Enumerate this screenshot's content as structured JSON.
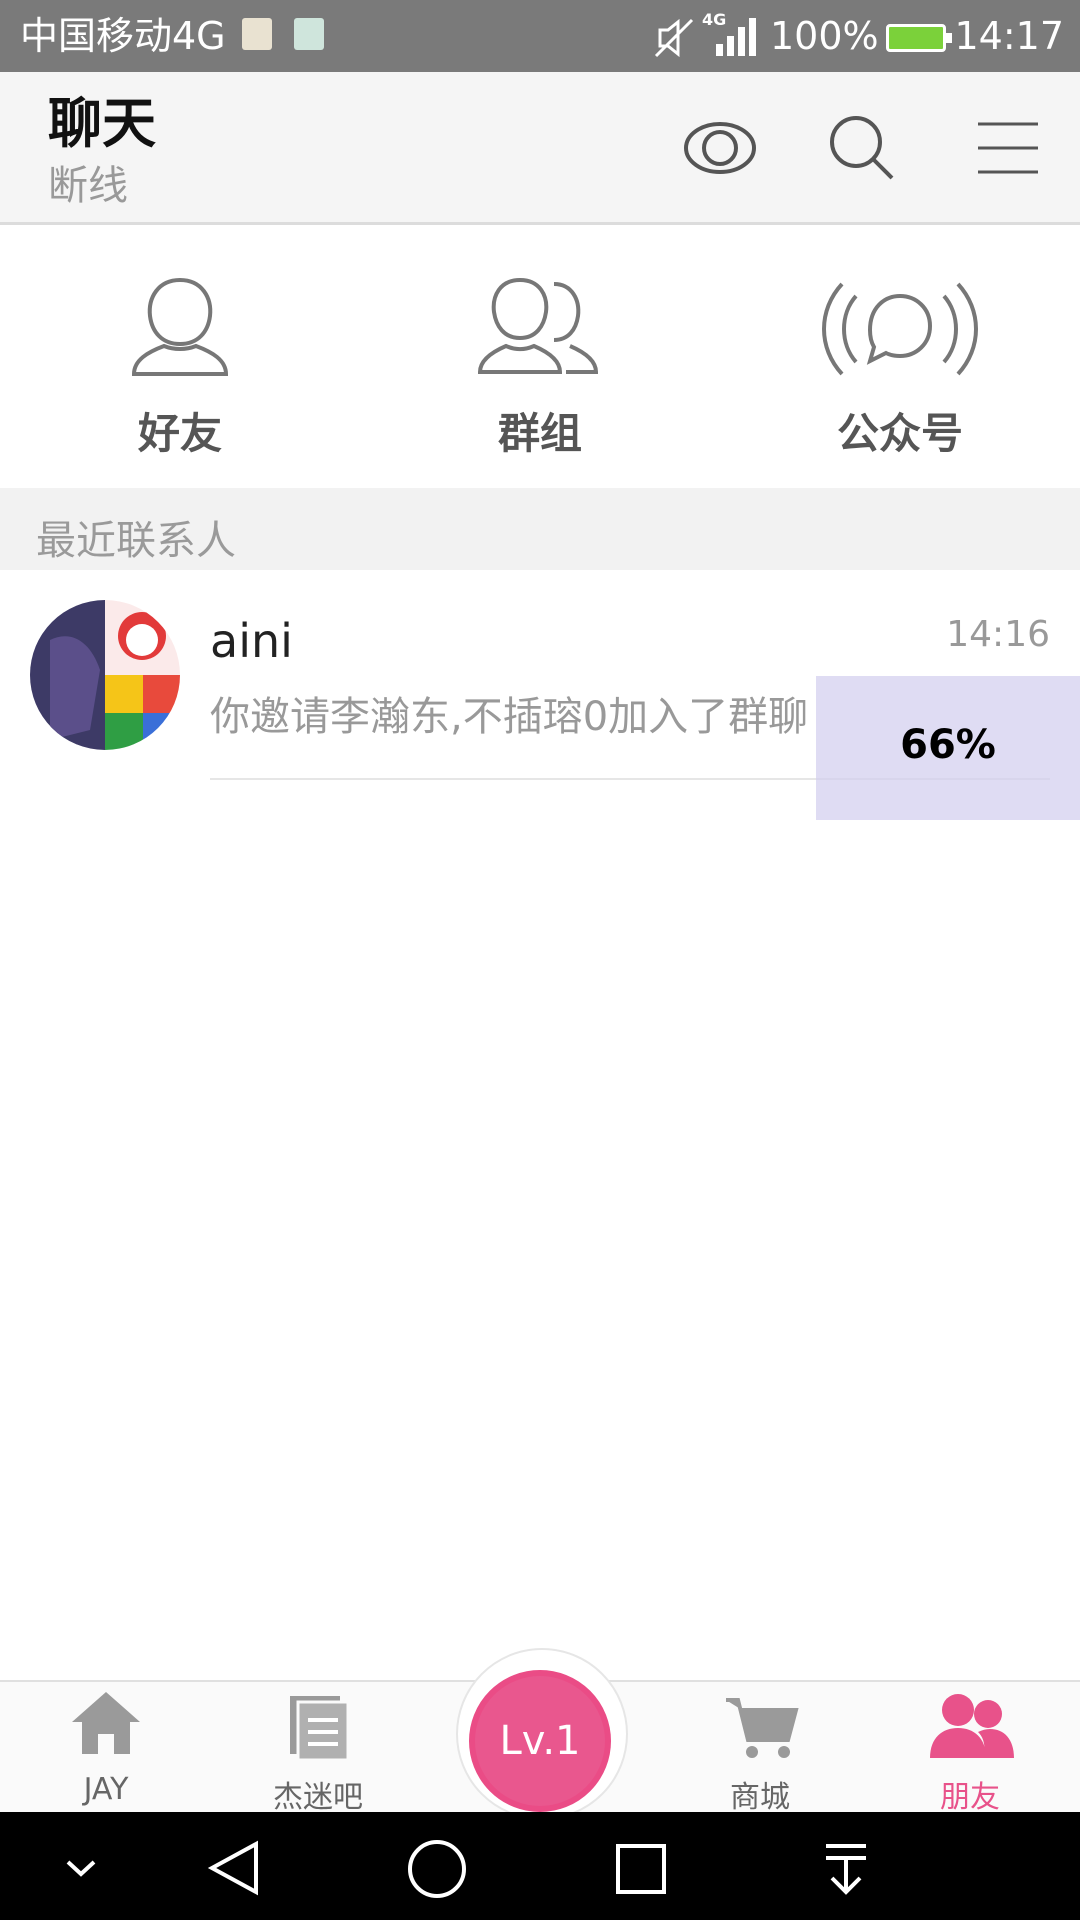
{
  "status_bar": {
    "carrier": "中国移动4G",
    "signal_type": "4G",
    "battery": "100%",
    "time": "14:17"
  },
  "header": {
    "title": "聊天",
    "subtitle": "断线",
    "icons": [
      "eye-icon",
      "search-icon",
      "menu-icon"
    ]
  },
  "entries": [
    {
      "label": "好友",
      "icon": "friend-icon"
    },
    {
      "label": "群组",
      "icon": "group-icon"
    },
    {
      "label": "公众号",
      "icon": "broadcast-icon"
    }
  ],
  "section": {
    "title": "最近联系人"
  },
  "conversation": {
    "name": "aini",
    "time": "14:16",
    "message": "你邀请李瀚东,不插瑢0加入了群聊"
  },
  "progress": {
    "label": "66%",
    "value": 66
  },
  "bottom_nav": {
    "items": [
      {
        "label": "JAY",
        "icon": "home-icon"
      },
      {
        "label": "杰迷吧",
        "icon": "forum-icon"
      },
      {
        "label": "商城",
        "icon": "cart-icon"
      },
      {
        "label": "朋友",
        "icon": "friends-icon",
        "active": true
      }
    ],
    "center": {
      "label": "Lv.1"
    }
  },
  "colors": {
    "accent": "#e8528a",
    "status_bar": "#7a7a7a",
    "header_bg": "#f5f5f5"
  }
}
